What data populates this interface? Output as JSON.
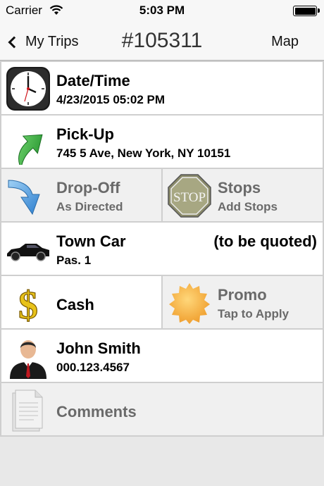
{
  "status_bar": {
    "carrier": "Carrier",
    "time": "5:03 PM"
  },
  "nav": {
    "back_label": "My Trips",
    "title": "#105311",
    "map_label": "Map"
  },
  "cells": {
    "datetime": {
      "title": "Date/Time",
      "value": "4/23/2015 05:02 PM",
      "icon": "clock-icon"
    },
    "pickup": {
      "title": "Pick-Up",
      "value": "745 5 Ave, New York, NY 10151",
      "icon": "green-arrow-up-icon"
    },
    "dropoff": {
      "title": "Drop-Off",
      "value": "As Directed",
      "icon": "blue-arrow-down-icon"
    },
    "stops": {
      "title": "Stops",
      "value": "Add Stops",
      "icon": "stop-sign-icon",
      "sign_text": "STOP"
    },
    "vehicle": {
      "title": "Town Car",
      "note": "(to be quoted)",
      "value": "Pas. 1",
      "icon": "car-icon"
    },
    "payment": {
      "title": "Cash",
      "icon": "dollar-icon"
    },
    "promo": {
      "title": "Promo",
      "value": "Tap to Apply",
      "icon": "promo-badge-icon"
    },
    "passenger": {
      "title": "John Smith",
      "value": "000.123.4567",
      "icon": "person-icon"
    },
    "comments": {
      "title": "Comments",
      "icon": "document-icon"
    }
  },
  "colors": {
    "cell_border": "#cfcfcf",
    "grey_cell": "#f0f0f0",
    "muted_text": "#6a6a6a"
  }
}
